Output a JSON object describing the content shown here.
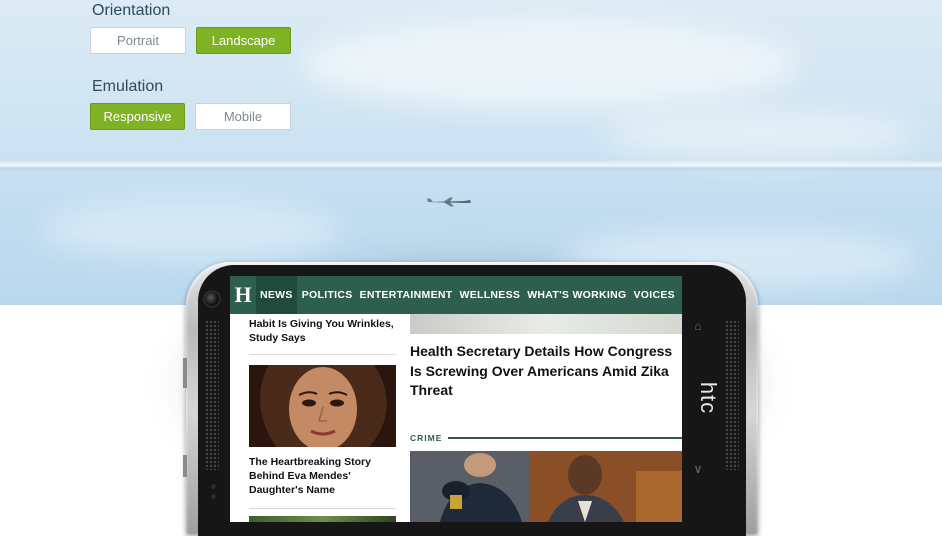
{
  "controls": {
    "orientation": {
      "label": "Orientation",
      "options": [
        {
          "label": "Portrait",
          "selected": false
        },
        {
          "label": "Landscape",
          "selected": true
        }
      ]
    },
    "emulation": {
      "label": "Emulation",
      "options": [
        {
          "label": "Responsive",
          "selected": true
        },
        {
          "label": "Mobile",
          "selected": false
        }
      ]
    }
  },
  "device": {
    "brand": "htc"
  },
  "site": {
    "logo": "H",
    "nav": [
      "NEWS",
      "POLITICS",
      "ENTERTAINMENT",
      "WELLNESS",
      "WHAT'S WORKING",
      "VOICES"
    ],
    "left_articles": [
      {
        "title": "Habit Is Giving You Wrinkles, Study Says"
      },
      {
        "title": "The Heartbreaking Story Behind Eva Mendes' Daughter's Name"
      }
    ],
    "main_headline": "Health Secretary Details How Congress Is Screwing Over Americans Amid Zika Threat",
    "section_label": "CRIME"
  },
  "colors": {
    "accent_green": "#7fb224",
    "site_nav": "#2e5e4e"
  }
}
